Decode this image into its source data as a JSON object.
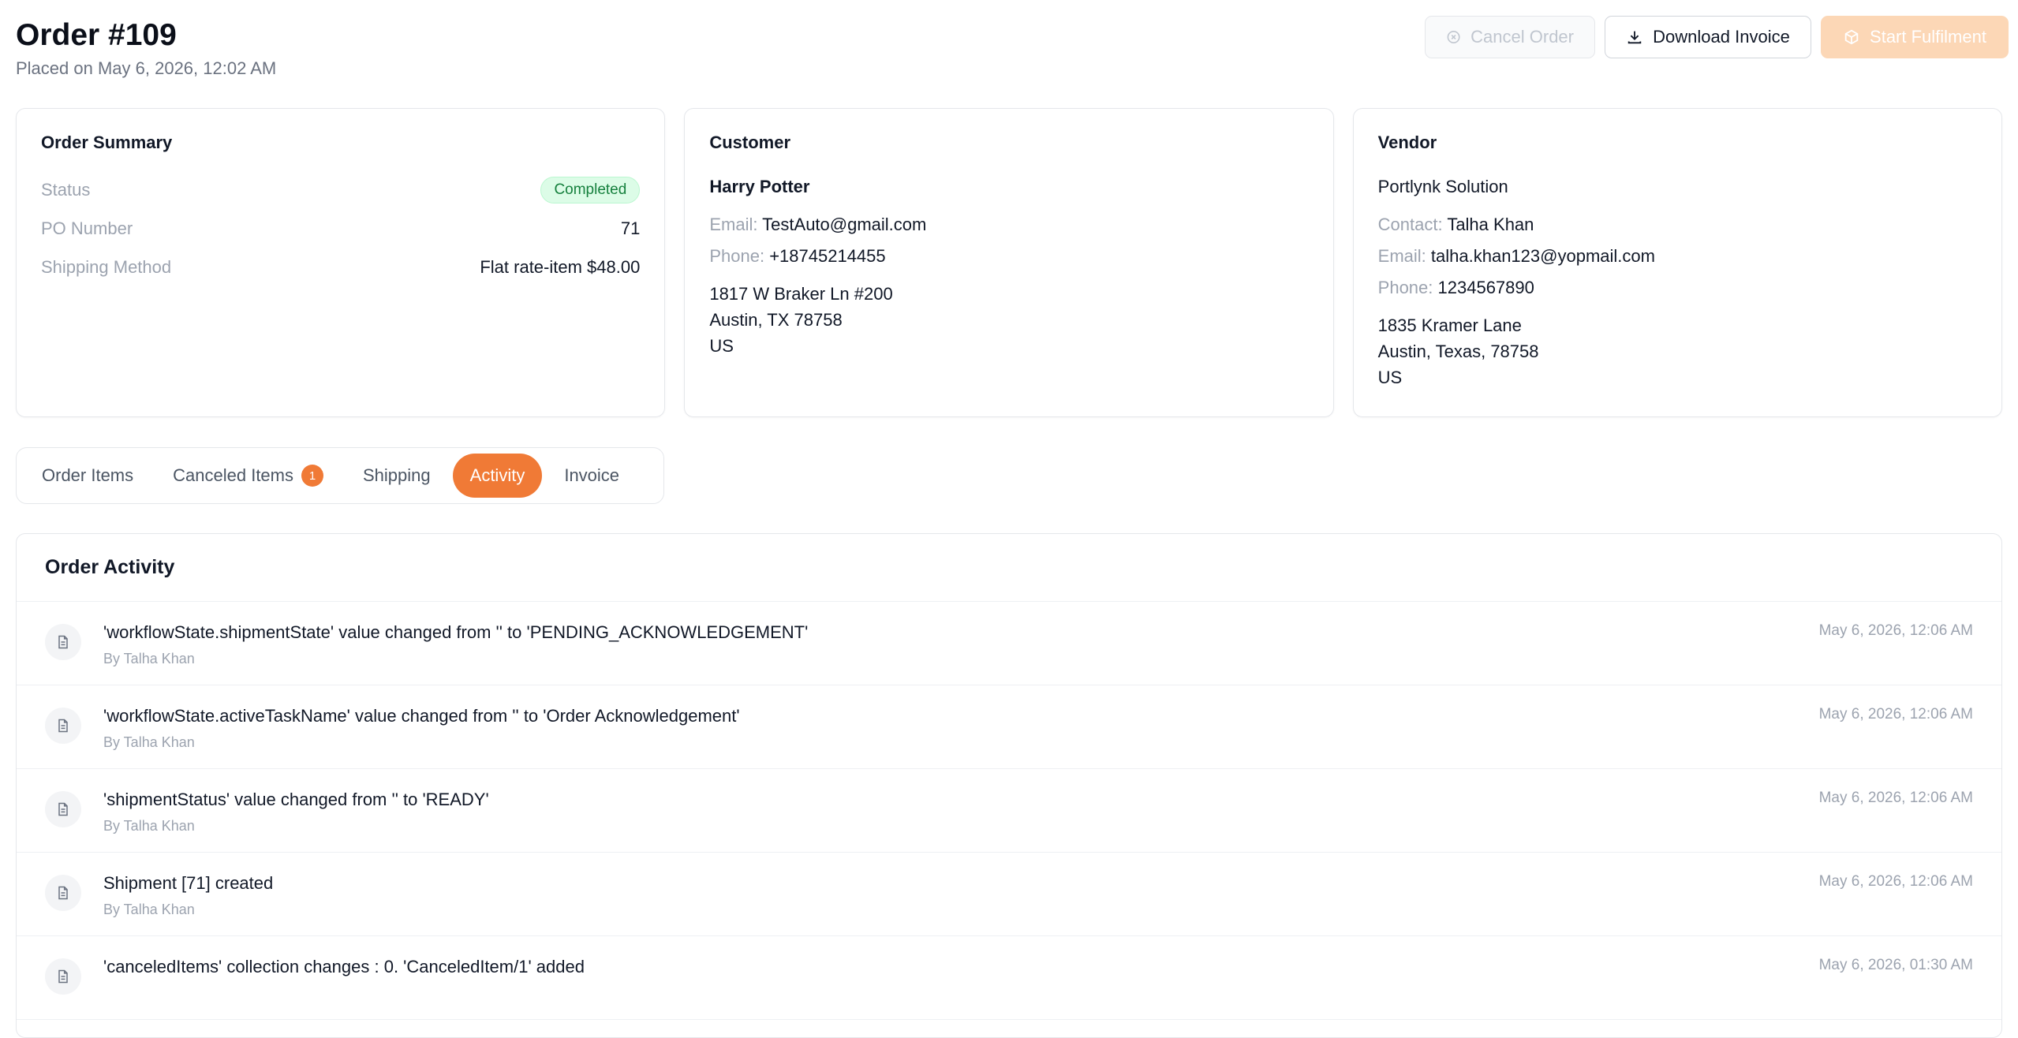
{
  "header": {
    "title": "Order #109",
    "placed": "Placed on May 6, 2026, 12:02 AM"
  },
  "actions": {
    "cancel": "Cancel Order",
    "download": "Download Invoice",
    "start": "Start Fulfilment"
  },
  "summary": {
    "title": "Order Summary",
    "status_label": "Status",
    "status_value": "Completed",
    "po_label": "PO Number",
    "po_value": "71",
    "shipping_label": "Shipping Method",
    "shipping_value": "Flat rate-item $48.00"
  },
  "customer": {
    "title": "Customer",
    "name": "Harry Potter",
    "email_label": "Email:",
    "email": "TestAuto@gmail.com",
    "phone_label": "Phone:",
    "phone": "+18745214455",
    "address1": "1817 W Braker Ln #200",
    "address2": "Austin, TX 78758",
    "country": "US"
  },
  "vendor": {
    "title": "Vendor",
    "name": "Portlynk Solution",
    "contact_label": "Contact:",
    "contact": "Talha Khan",
    "email_label": "Email:",
    "email": "talha.khan123@yopmail.com",
    "phone_label": "Phone:",
    "phone": "1234567890",
    "address1": "1835 Kramer Lane",
    "address2": "Austin, Texas, 78758",
    "country": "US"
  },
  "tabs": {
    "order_items": "Order Items",
    "canceled_items": "Canceled Items",
    "canceled_count": "1",
    "shipping": "Shipping",
    "activity": "Activity",
    "invoice": "Invoice"
  },
  "activity": {
    "title": "Order Activity",
    "items": [
      {
        "text": "'workflowState.shipmentState' value changed from '' to 'PENDING_ACKNOWLEDGEMENT'",
        "by": "By Talha Khan",
        "time": "May 6, 2026, 12:06 AM"
      },
      {
        "text": "'workflowState.activeTaskName' value changed from '' to 'Order Acknowledgement'",
        "by": "By Talha Khan",
        "time": "May 6, 2026, 12:06 AM"
      },
      {
        "text": "'shipmentStatus' value changed from '' to 'READY'",
        "by": "By Talha Khan",
        "time": "May 6, 2026, 12:06 AM"
      },
      {
        "text": "Shipment [71] created",
        "by": "By Talha Khan",
        "time": "May 6, 2026, 12:06 AM"
      },
      {
        "text": "'canceledItems' collection changes : 0. 'CanceledItem/1' added",
        "by": "",
        "time": "May 6, 2026, 01:30 AM"
      }
    ]
  },
  "colors": {
    "accent": "#f07a36",
    "accent_disabled": "#fcd7b6",
    "success_bg": "#dcfce7",
    "success_text": "#15803d"
  }
}
